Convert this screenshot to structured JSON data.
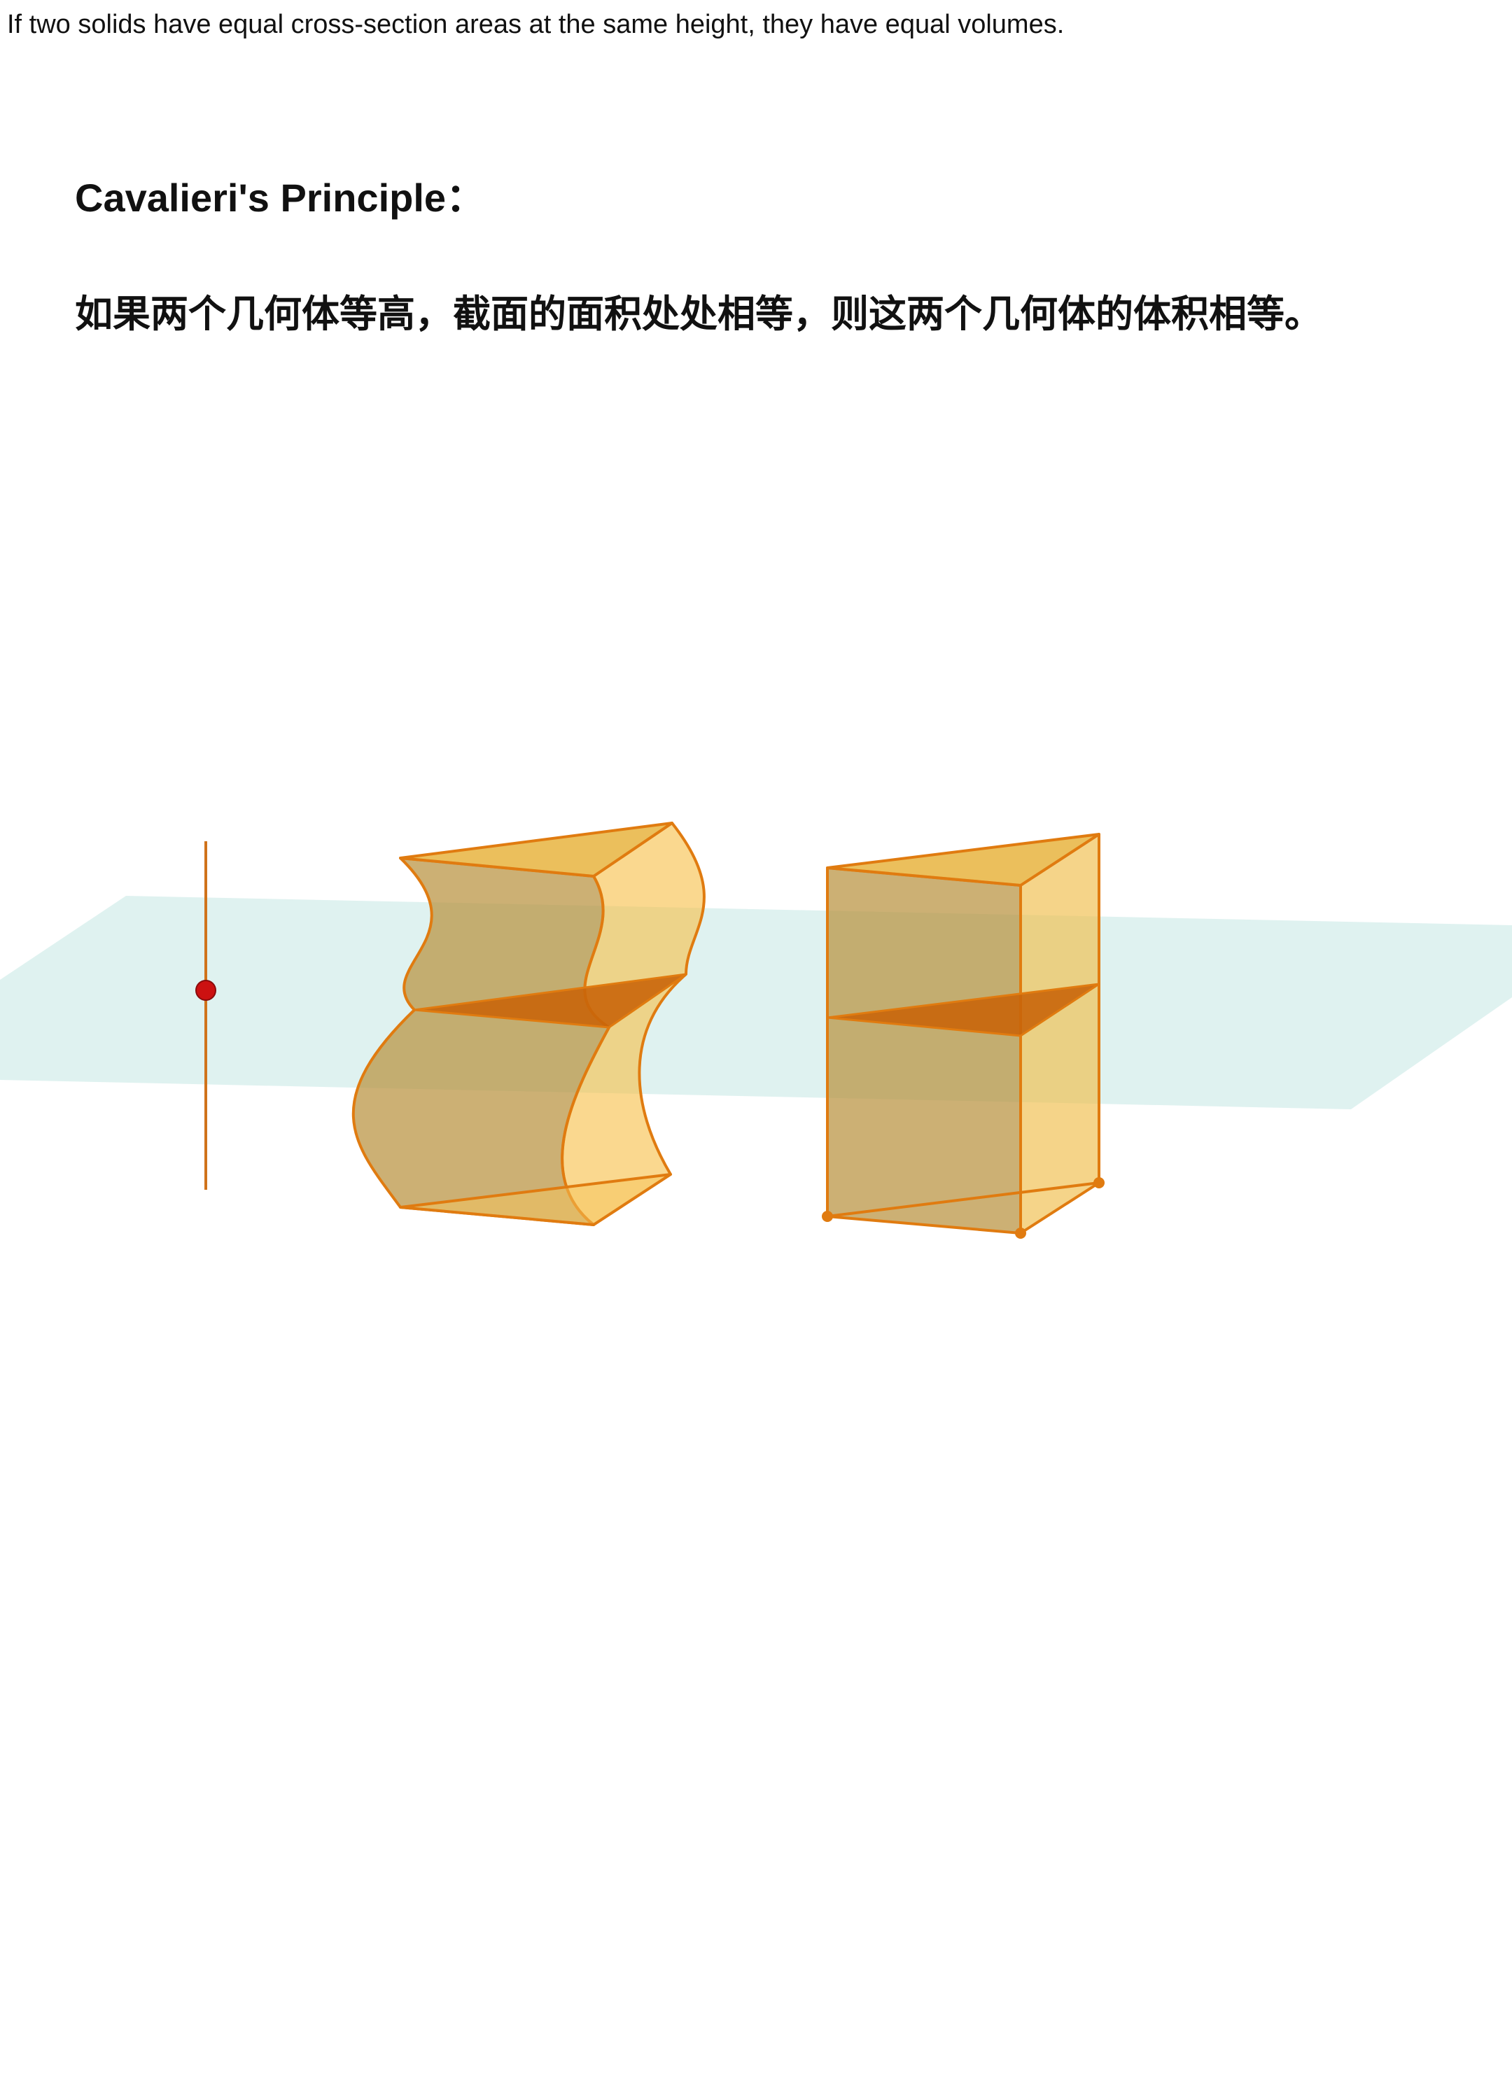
{
  "caption": "If two solids have equal cross-section areas at the same height, they have equal volumes.",
  "heading": "Cavalieri's Principle：",
  "statement": "如果两个几何体等高，截面的面积处处相等，则这两个几何体的体积相等。",
  "colors": {
    "solid_fill": "#f5b82e",
    "solid_edge": "#e07b10",
    "cross_section": "#c9650a",
    "plane": "#bfe5e2",
    "height_point": "#cc1111"
  }
}
